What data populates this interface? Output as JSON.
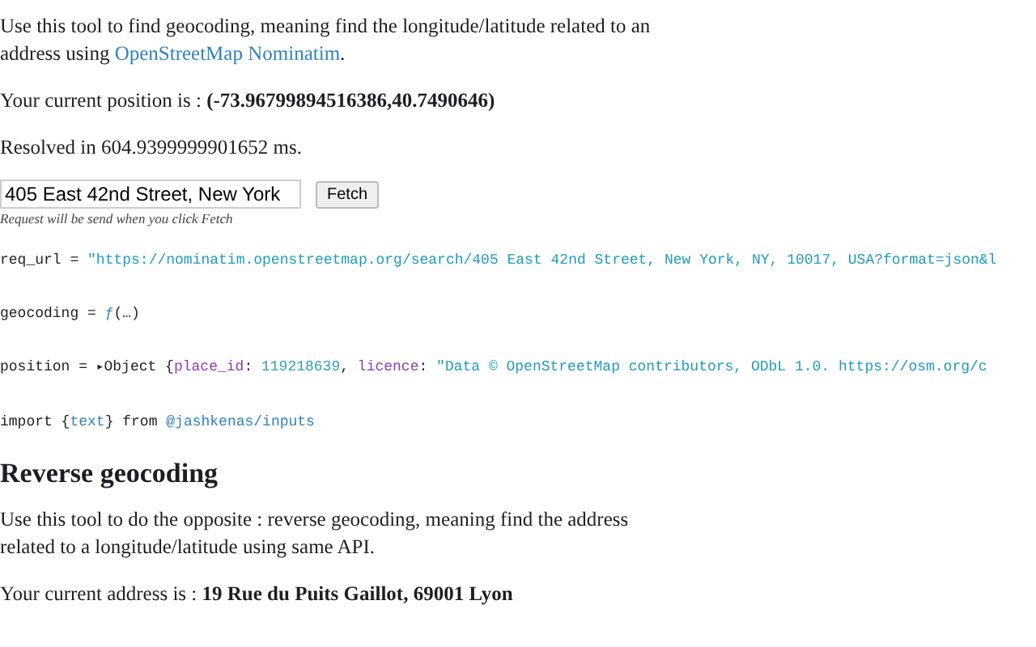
{
  "intro": {
    "before": "Use this tool to find geocoding, meaning find the longitude/latitude related to an address using ",
    "link": "OpenStreetMap Nominatim",
    "after": "."
  },
  "position_text": "Your current position is : **(-73.96799894516386,40.7490646)**",
  "resolved_text": "Resolved in 604.9399999901652 ms.",
  "address_input": {
    "value": "405 East 42nd Street, New York",
    "button": "Fetch",
    "note": "Request will be send when you click Fetch"
  },
  "cells": [
    {
      "tokens": [
        {
          "kind": "plain",
          "text": "req_url = "
        },
        {
          "kind": "string",
          "text": "\"https://nominatim.openstreetmap.org/search/405 East 42nd Street, New York, NY, 10017, USA?format=json&l"
        }
      ]
    },
    {
      "tokens": [
        {
          "kind": "plain",
          "text": "geocoding = "
        },
        {
          "kind": "fn",
          "text": "ƒ"
        },
        {
          "kind": "plain",
          "text": "(…)"
        }
      ]
    },
    {
      "tokens": [
        {
          "kind": "plain",
          "text": "position = "
        },
        {
          "kind": "toggle",
          "text": "▸"
        },
        {
          "kind": "plain",
          "text": "Object {"
        },
        {
          "kind": "key",
          "text": "place_id"
        },
        {
          "kind": "plain",
          "text": ": "
        },
        {
          "kind": "number",
          "text": "119218639"
        },
        {
          "kind": "plain",
          "text": ", "
        },
        {
          "kind": "key",
          "text": "licence"
        },
        {
          "kind": "plain",
          "text": ": "
        },
        {
          "kind": "string",
          "text": "\"Data © OpenStreetMap contributors, ODbL 1.0. https://osm.org/c"
        }
      ]
    },
    {
      "tokens": [
        {
          "kind": "plain",
          "text": "import {"
        },
        {
          "kind": "fn",
          "text": "text"
        },
        {
          "kind": "plain",
          "text": "} from "
        },
        {
          "kind": "module",
          "text": "@jashkenas/inputs"
        }
      ]
    }
  ],
  "reverse": {
    "heading": "Reverse geocoding",
    "description": "Use this tool to do the opposite : reverse geocoding, meaning find the address related to a longitude/latitude using same API.",
    "address_text": "Your current address is : **19 Rue du Puits Gaillot, 69001 Lyon**"
  }
}
